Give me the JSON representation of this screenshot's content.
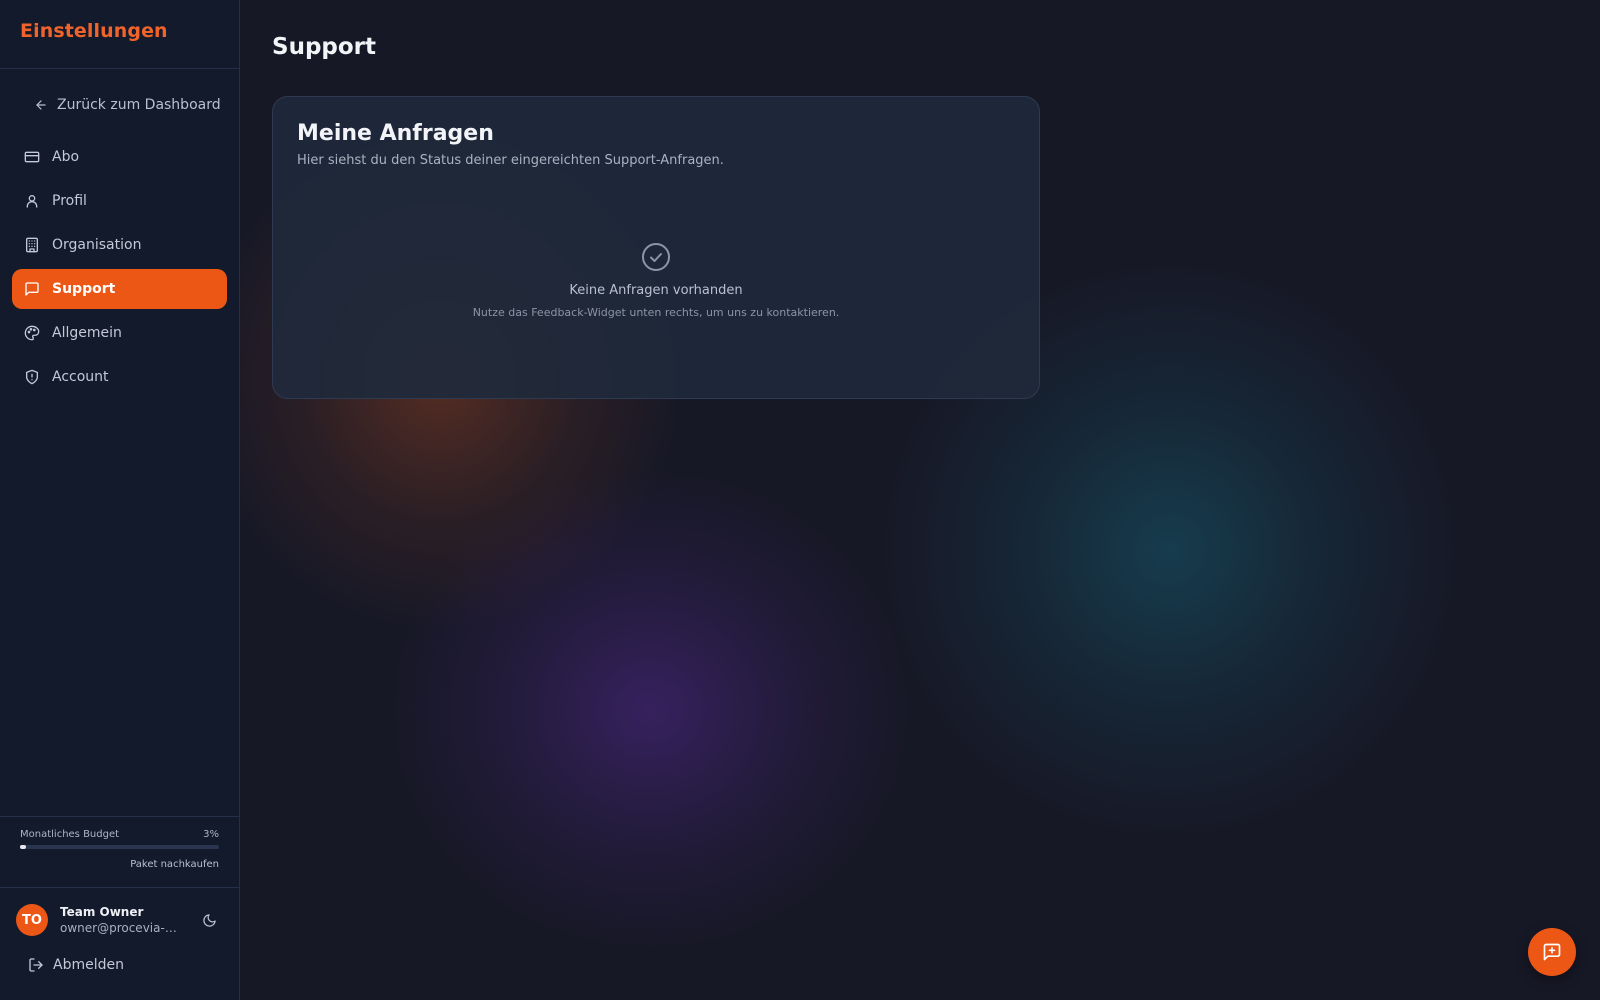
{
  "sidebar": {
    "title": "Einstellungen",
    "back_label": "Zurück zum Dashboard",
    "items": [
      {
        "label": "Abo",
        "icon": "credit-card-icon"
      },
      {
        "label": "Profil",
        "icon": "user-icon"
      },
      {
        "label": "Organisation",
        "icon": "building-icon"
      },
      {
        "label": "Support",
        "icon": "message-square-icon",
        "active": true
      },
      {
        "label": "Allgemein",
        "icon": "palette-icon"
      },
      {
        "label": "Account",
        "icon": "shield-icon"
      }
    ],
    "budget": {
      "label": "Monatliches Budget",
      "percent_text": "3%",
      "percent_value": 3,
      "link": "Paket nachkaufen"
    },
    "user": {
      "initials": "TO",
      "name": "Team Owner",
      "email": "owner@procevia-te..."
    },
    "logout_label": "Abmelden"
  },
  "main": {
    "page_title": "Support",
    "card": {
      "title": "Meine Anfragen",
      "subtitle": "Hier siehst du den Status deiner eingereichten Support-Anfragen.",
      "empty_title": "Keine Anfragen vorhanden",
      "empty_subtitle": "Nutze das Feedback-Widget unten rechts, um uns zu kontaktieren."
    }
  },
  "fab_icon": "message-plus-icon",
  "colors": {
    "accent": "#ec5716",
    "background": "#171826",
    "sidebar_bg": "#121a2b",
    "card_bg": "#1f293b"
  }
}
